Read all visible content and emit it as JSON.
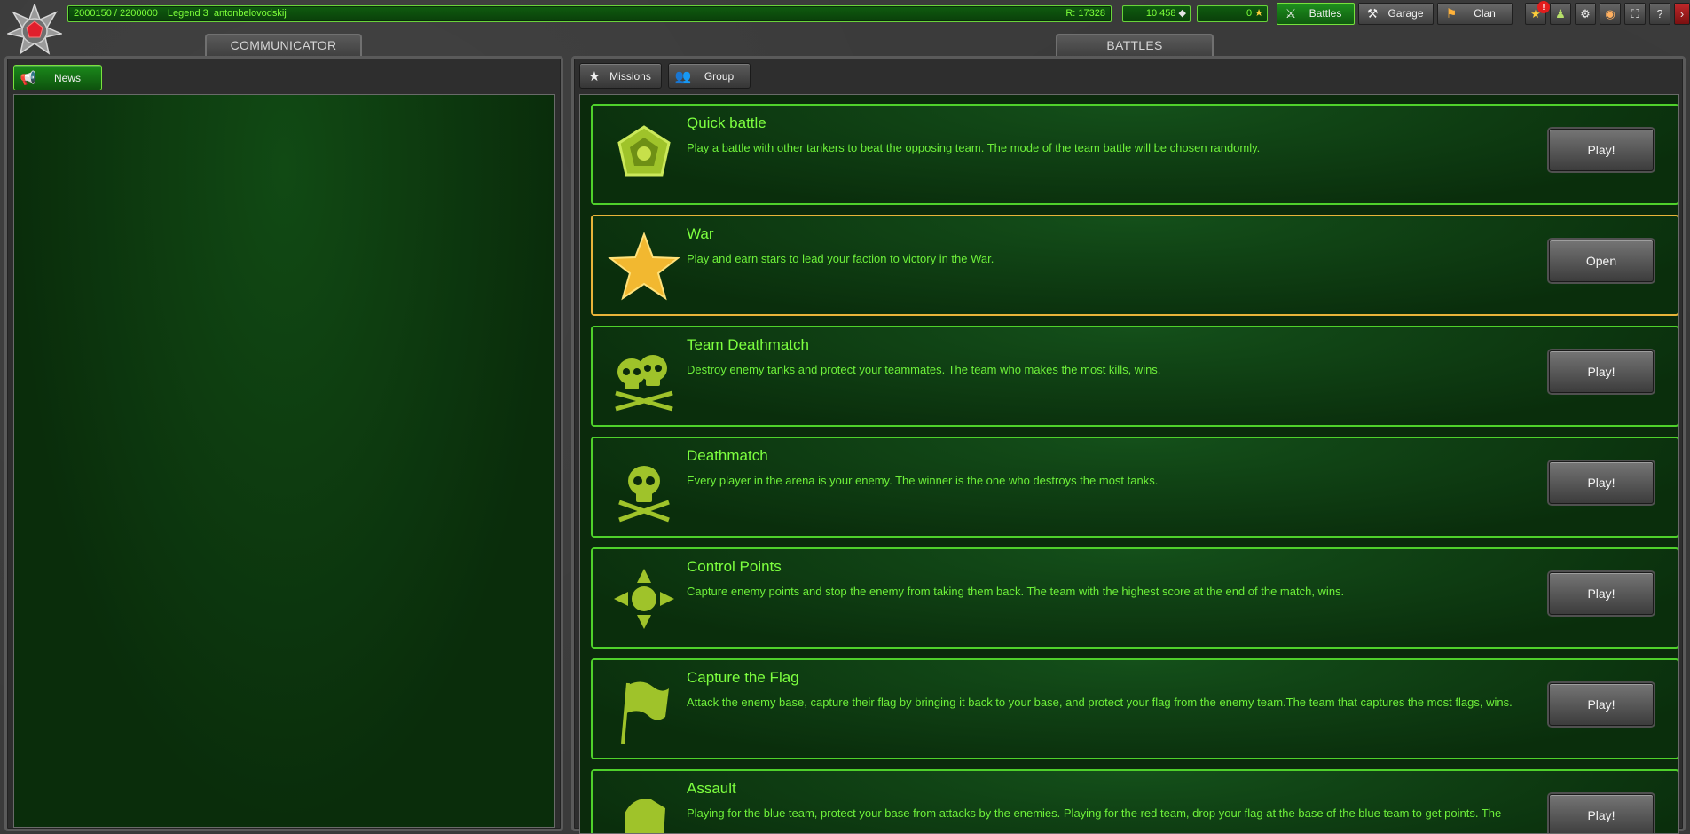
{
  "topbar": {
    "xp": "2000150 / 2200000",
    "rank": "Legend 3",
    "username": "antonbelovodskij",
    "rating": "R: 17328",
    "crystals": "10 458",
    "stars": "0",
    "nav": {
      "battles": "Battles",
      "garage": "Garage",
      "clan": "Clan"
    },
    "notification_count": "!"
  },
  "communicator": {
    "tab_label": "COMMUNICATOR",
    "news_button": "News"
  },
  "battles": {
    "tab_label": "BATTLES",
    "missions_button": "Missions",
    "group_button": "Group",
    "modes": [
      {
        "title": "Quick battle",
        "description": "Play a battle with other tankers to beat the opposing team. The mode of the team battle will be chosen randomly.",
        "button": "Play!",
        "icon": "quick-battle-icon"
      },
      {
        "title": "War",
        "description": "Play and earn stars to lead your faction to victory in the War.",
        "button": "Open",
        "icon": "star-icon"
      },
      {
        "title": "Team Deathmatch",
        "description": "Destroy enemy tanks and protect your teammates. The team who makes the most kills, wins.",
        "button": "Play!",
        "icon": "two-skulls-icon"
      },
      {
        "title": "Deathmatch",
        "description": "Every player in the arena is your enemy. The winner is the one who destroys the most tanks.",
        "button": "Play!",
        "icon": "skull-icon"
      },
      {
        "title": "Control Points",
        "description": "Capture enemy points and stop the enemy from taking them back. The team with the highest score at the end of the match, wins.",
        "button": "Play!",
        "icon": "control-point-icon"
      },
      {
        "title": "Capture the Flag",
        "description": "Attack the enemy base, capture their flag by bringing it back to your base, and protect your flag from the enemy team.The team that captures the most flags, wins.",
        "button": "Play!",
        "icon": "flag-icon"
      },
      {
        "title": "Assault",
        "description": "Playing for the blue team, protect your base from attacks by the enemies. Playing for the red team, drop your flag at the base of the blue team to get points. The",
        "button": "Play!",
        "icon": "assault-icon"
      }
    ]
  }
}
